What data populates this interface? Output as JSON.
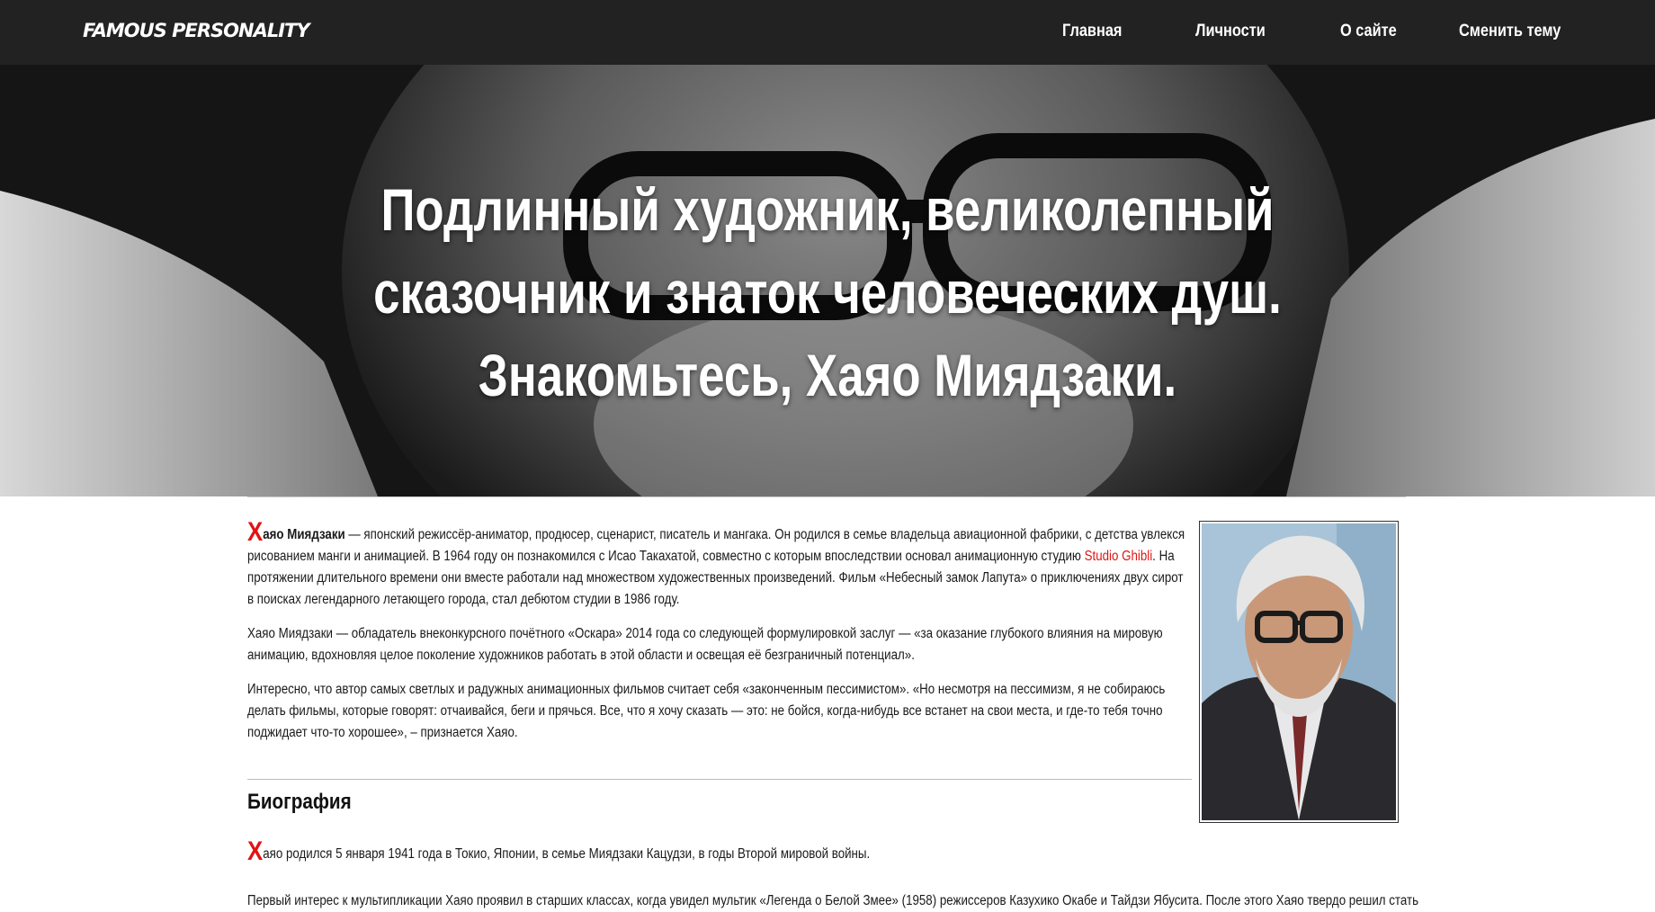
{
  "navbar": {
    "brand": "FAMOUS PERSONALITY",
    "items": [
      {
        "label": "Главная"
      },
      {
        "label": "Личности"
      },
      {
        "label": "О сайте"
      },
      {
        "label": "Сменить тему"
      }
    ]
  },
  "hero": {
    "lines": [
      "Подлинный художник, великолепный",
      "сказочник и знаток человеческих душ.",
      "Знакомьтесь, Хаяо Миядзаки."
    ]
  },
  "article": {
    "p1": {
      "dropcap": "Х",
      "name_bold": "аяо Миядзаки",
      "text1": " — японский режиссёр-аниматор, продюсер, сценарист, писатель и мангака. Он родился в семье владельца авиационной фабрики, с детства увлекся рисованием манги и анимацией. В 1964 году он познакомился с Исао Такахатой, совместно с которым впоследствии основал анимационную студию ",
      "link": "Studio Ghibli",
      "text2": ". На протяжении длительного времени они вместе работали над множеством художественных произведений. Фильм «Небесный замок Лапута» о приключениях двух сирот в поисках легендарного летающего города, стал дебютом студии в 1986 году."
    },
    "p2": "Хаяо Миядзаки — обладатель внеконкурсного почётного «Оскара» 2014 года со следующей формулировкой заслуг — «за оказание глубокого влияния на мировую анимацию, вдохновляя целое поколение художников работать в этой области и освещая её безграничный потенциал».",
    "p3": "Интересно, что автор самых светлых и радужных анимационных фильмов считает себя «законченным пессимистом». «Но несмотря на пессимизм, я не собираюсь делать фильмы, которые говорят: отчаивайся, беги и прячься. Все, что я хочу сказать — это: не бойся, когда-нибудь все встанет на свои места, и где-то тебя точно поджидает что-то хорошее», – признается Хаяо.",
    "section_title": "Биография",
    "bio1": {
      "dropcap": "Х",
      "text": "аяо родился 5 января 1941 года в Токио, Японии, в семье Миядзаки Кацудзи, в годы Второй мировой войны."
    },
    "bio2": "Первый интерес к мультипликации Хаяо проявил в старших классах, когда увидел мультик «Легенда о Белой Змее» (1958) режиссеров Казухико Окабе и Тайдзи Ябусита. После этого Хаяо твердо решил стать"
  },
  "colors": {
    "navbar_bg": "#222222",
    "accent_red": "#e01414",
    "text": "#1a1a1a"
  }
}
